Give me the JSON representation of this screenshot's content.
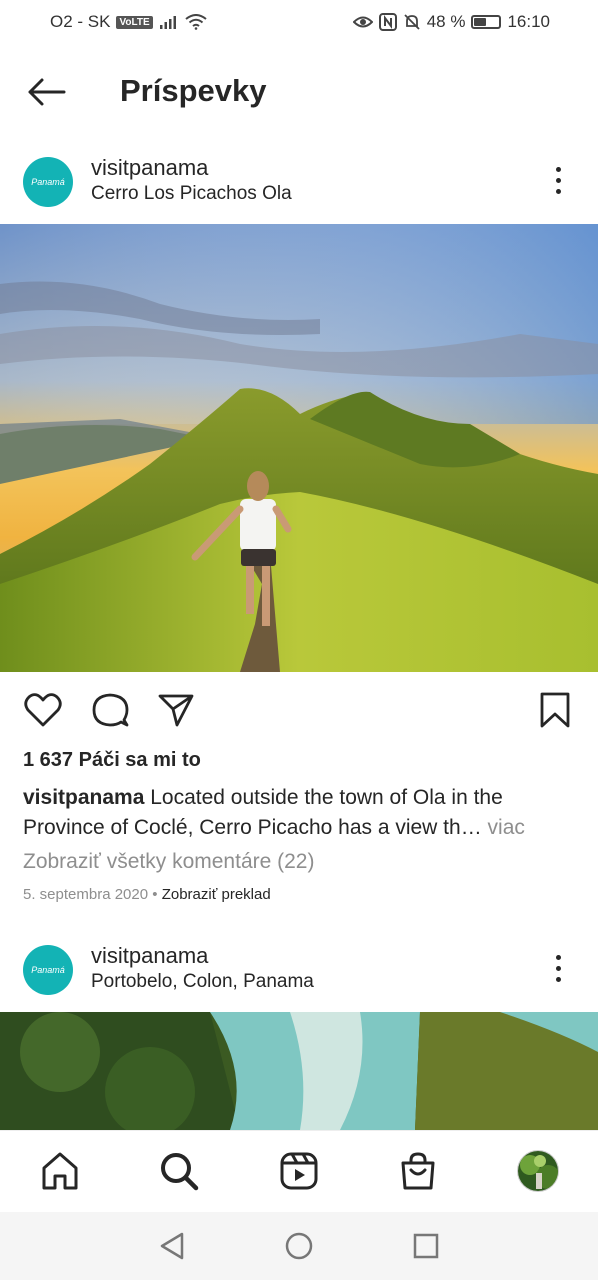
{
  "status_bar": {
    "carrier": "O2 - SK",
    "volte": "VoLTE",
    "battery_text": "48 %",
    "battery_level": 0.48,
    "time": "16:10"
  },
  "header": {
    "title": "Príspevky"
  },
  "posts": [
    {
      "avatar_text": "Panamá",
      "username": "visitpanama",
      "location": "Cerro Los Picachos Ola",
      "likes": "1 637 Páči sa mi to",
      "caption_user": "visitpanama",
      "caption_text": " Located outside the town of Ola in the Province of Coclé, Cerro Picacho has a view th…",
      "caption_more": " viac",
      "view_comments": "Zobraziť všetky komentáre (22)",
      "date": "5. septembra 2020",
      "separator": " • ",
      "translate": "Zobraziť preklad"
    },
    {
      "avatar_text": "Panamá",
      "username": "visitpanama",
      "location": "Portobelo, Colon, Panama"
    }
  ],
  "icons": {
    "back": "arrow-left-icon",
    "more": "more-vertical-icon",
    "like": "heart-icon",
    "comment": "comment-icon",
    "share": "send-icon",
    "save": "bookmark-icon",
    "home": "home-icon",
    "search": "search-icon",
    "reels": "reels-icon",
    "shop": "shopping-bag-icon"
  },
  "colors": {
    "brand_teal": "#13b3b5",
    "muted_text": "#8e8e8e",
    "text": "#262626"
  }
}
